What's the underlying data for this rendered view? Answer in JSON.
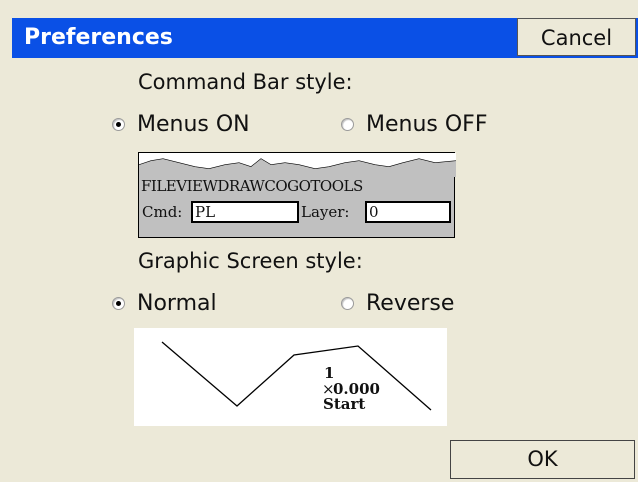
{
  "dialog": {
    "title": "Preferences",
    "cancel_label": "Cancel",
    "ok_label": "OK"
  },
  "command_bar": {
    "heading": "Command Bar style:",
    "options": [
      {
        "label": "Menus ON",
        "selected": true
      },
      {
        "label": "Menus OFF",
        "selected": false
      }
    ],
    "preview": {
      "menus": [
        "FILE",
        "VIEW",
        "DRAW",
        "COGO",
        "TOOLS"
      ],
      "cmd_label": "Cmd:",
      "cmd_value": "PL",
      "layer_label": "Layer:",
      "layer_value": "0"
    }
  },
  "graphic_screen": {
    "heading": "Graphic Screen style:",
    "options": [
      {
        "label": "Normal",
        "selected": true
      },
      {
        "label": "Reverse",
        "selected": false
      }
    ],
    "preview": {
      "point_number": "1",
      "elevation": "0.000",
      "point_marker": "×",
      "description": "Start"
    }
  },
  "colors": {
    "title_bar": "#0a50e6",
    "dialog_bg": "#ece9d8",
    "preview_bg": "#c0c0c0"
  }
}
